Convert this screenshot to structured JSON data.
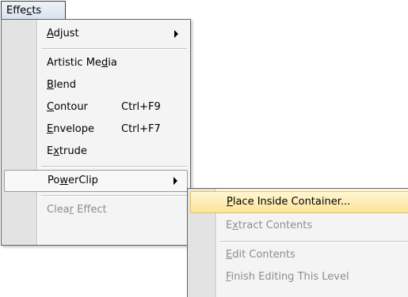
{
  "menubar": {
    "title_pre": "Effe",
    "title_mn": "c",
    "title_post": "ts"
  },
  "effects_menu": {
    "items": [
      {
        "pre": "",
        "mn": "A",
        "post": "djust",
        "shortcut": "",
        "submenu": true,
        "disabled": false
      },
      {
        "pre": "Artistic Me",
        "mn": "d",
        "post": "ia",
        "shortcut": "",
        "submenu": false,
        "disabled": false
      },
      {
        "pre": "",
        "mn": "B",
        "post": "lend",
        "shortcut": "",
        "submenu": false,
        "disabled": false
      },
      {
        "pre": "",
        "mn": "C",
        "post": "ontour",
        "shortcut": "Ctrl+F9",
        "submenu": false,
        "disabled": false
      },
      {
        "pre": "",
        "mn": "E",
        "post": "nvelope",
        "shortcut": "Ctrl+F7",
        "submenu": false,
        "disabled": false
      },
      {
        "pre": "E",
        "mn": "x",
        "post": "trude",
        "shortcut": "",
        "submenu": false,
        "disabled": false
      },
      {
        "pre": "Po",
        "mn": "w",
        "post": "erClip",
        "shortcut": "",
        "submenu": true,
        "disabled": false
      },
      {
        "pre": "Clea",
        "mn": "r",
        "post": " Effect",
        "shortcut": "",
        "submenu": false,
        "disabled": true
      }
    ]
  },
  "powerclip_menu": {
    "items": [
      {
        "pre": "",
        "mn": "P",
        "post": "lace Inside Container...",
        "disabled": false
      },
      {
        "pre": "E",
        "mn": "x",
        "post": "tract Contents",
        "disabled": true
      },
      {
        "pre": "",
        "mn": "E",
        "post": "dit Contents",
        "disabled": true
      },
      {
        "pre": "",
        "mn": "F",
        "post": "inish Editing This Level",
        "disabled": true
      }
    ]
  },
  "colors": {
    "highlight_top": "#fff6d2",
    "highlight_bottom": "#fde39a",
    "highlight_border": "#e6c256",
    "disabled_text": "#8d8d8d"
  }
}
